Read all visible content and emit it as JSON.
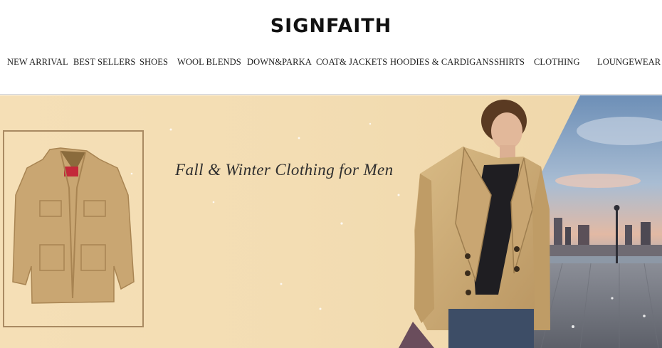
{
  "brand": {
    "logo_text": "SIGNFAITH"
  },
  "nav": {
    "items": [
      {
        "label": "NEW ARRIVAL"
      },
      {
        "label": "BEST SELLERS"
      },
      {
        "label": "SHOES"
      },
      {
        "label": "WOOL BLENDS"
      },
      {
        "label": "DOWN&PARKA"
      },
      {
        "label": "COAT& JACKETS"
      },
      {
        "label": "HOODIES & CARDIGANS"
      },
      {
        "label": "SHIRTS"
      },
      {
        "label": "CLOTHING"
      },
      {
        "label": "LOUNGEWEAR"
      }
    ]
  },
  "banner": {
    "headline": "Fall & Winter Clothing for Men",
    "colors": {
      "background": "#f5dfb6",
      "frame": "#a98a62",
      "coat": "#c9a672"
    }
  }
}
